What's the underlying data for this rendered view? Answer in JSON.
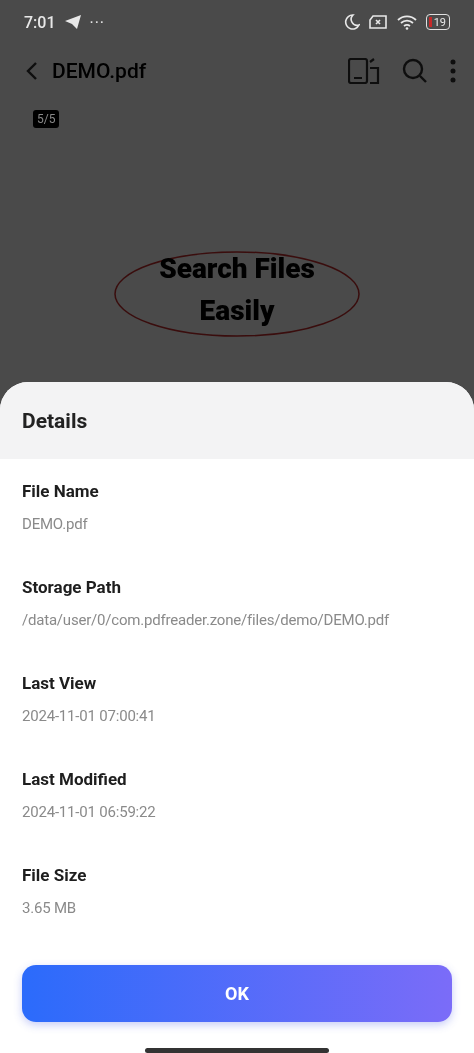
{
  "status_bar": {
    "time": "7:01",
    "more": "···",
    "battery": "19"
  },
  "app_bar": {
    "title": "DEMO.pdf"
  },
  "page_indicator": "5/5",
  "document": {
    "heading_lines": [
      "Search Files",
      "Easily"
    ]
  },
  "details_sheet": {
    "title": "Details",
    "fields": [
      {
        "label": "File Name",
        "value": "DEMO.pdf"
      },
      {
        "label": "Storage Path",
        "value": "/data/user/0/com.pdfreader.zone/files/demo/DEMO.pdf"
      },
      {
        "label": "Last View",
        "value": "2024-11-01 07:00:41"
      },
      {
        "label": "Last Modified",
        "value": "2024-11-01 06:59:22"
      },
      {
        "label": "File Size",
        "value": "3.65 MB"
      }
    ],
    "ok_button": "OK"
  }
}
